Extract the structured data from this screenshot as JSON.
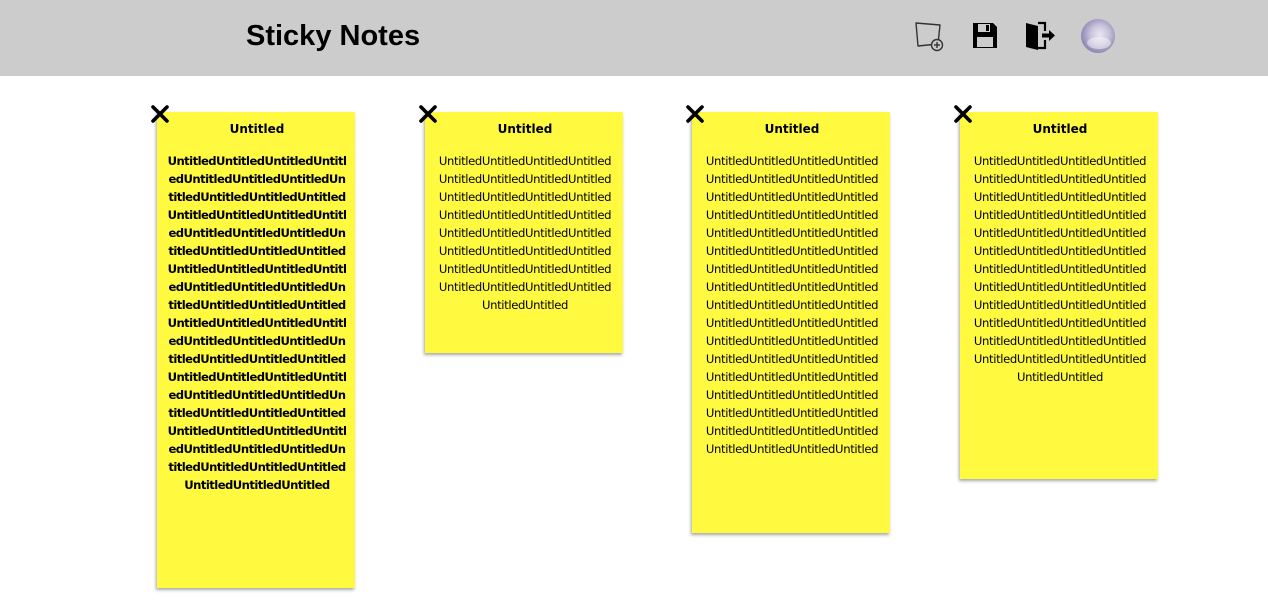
{
  "header": {
    "title": "Sticky Notes",
    "icons": {
      "add_note": "add-note-icon",
      "save": "save-icon",
      "logout": "logout-icon",
      "avatar": "user-avatar"
    }
  },
  "colors": {
    "header_bg": "#cccccc",
    "note_bg": "#fff93f",
    "text": "#000000"
  },
  "notes": [
    {
      "title": "Untitled",
      "body": "UntitledUntitledUntitledUntitledUntitledUntitledUntitledUntitledUntitledUntitledUntitledUntitledUntitledUntitledUntitledUntitledUntitledUntitledUntitledUntitledUntitledUntitledUntitledUntitledUntitledUntitledUntitledUntitledUntitledUntitledUntitledUntitledUntitledUntitledUntitledUntitledUntitledUntitledUntitledUntitledUntitledUntitledUntitledUntitledUntitledUntitledUntitledUntitledUntitledUntitledUntitledUntitledUntitledUntitledUntitledUntitledUntitledUntitledUntitledUntitledUntitledUntitledUntitledUntitledUntitledUntitledUntitledUntitledUntitled",
      "bold": true
    },
    {
      "title": "Untitled",
      "body": "UntitledUntitledUntitledUntitledUntitledUntitledUntitledUntitledUntitledUntitledUntitledUntitledUntitledUntitledUntitledUntitledUntitledUntitledUntitledUntitledUntitledUntitledUntitledUntitledUntitledUntitledUntitledUntitledUntitledUntitledUntitledUntitledUntitledUntitled",
      "bold": false
    },
    {
      "title": "Untitled",
      "body": "UntitledUntitledUntitledUntitledUntitledUntitledUntitledUntitledUntitledUntitledUntitledUntitledUntitledUntitledUntitledUntitledUntitledUntitledUntitledUntitledUntitledUntitledUntitledUntitledUntitledUntitledUntitledUntitledUntitledUntitledUntitledUntitledUntitledUntitledUntitledUntitledUntitledUntitledUntitledUntitledUntitledUntitledUntitledUntitledUntitledUntitledUntitledUntitledUntitledUntitledUntitledUntitledUntitledUntitledUntitledUntitledUntitledUntitledUntitledUntitledUntitledUntitledUntitledUntitledUntitledUntitledUntitledUntitled",
      "bold": false
    },
    {
      "title": "Untitled",
      "body": "UntitledUntitledUntitledUntitledUntitledUntitledUntitledUntitledUntitledUntitledUntitledUntitledUntitledUntitledUntitledUntitledUntitledUntitledUntitledUntitledUntitledUntitledUntitledUntitledUntitledUntitledUntitledUntitledUntitledUntitledUntitledUntitledUntitledUntitledUntitledUntitledUntitledUntitledUntitledUntitledUntitledUntitledUntitledUntitledUntitledUntitledUntitledUntitledUntitledUntitled",
      "bold": false
    }
  ]
}
